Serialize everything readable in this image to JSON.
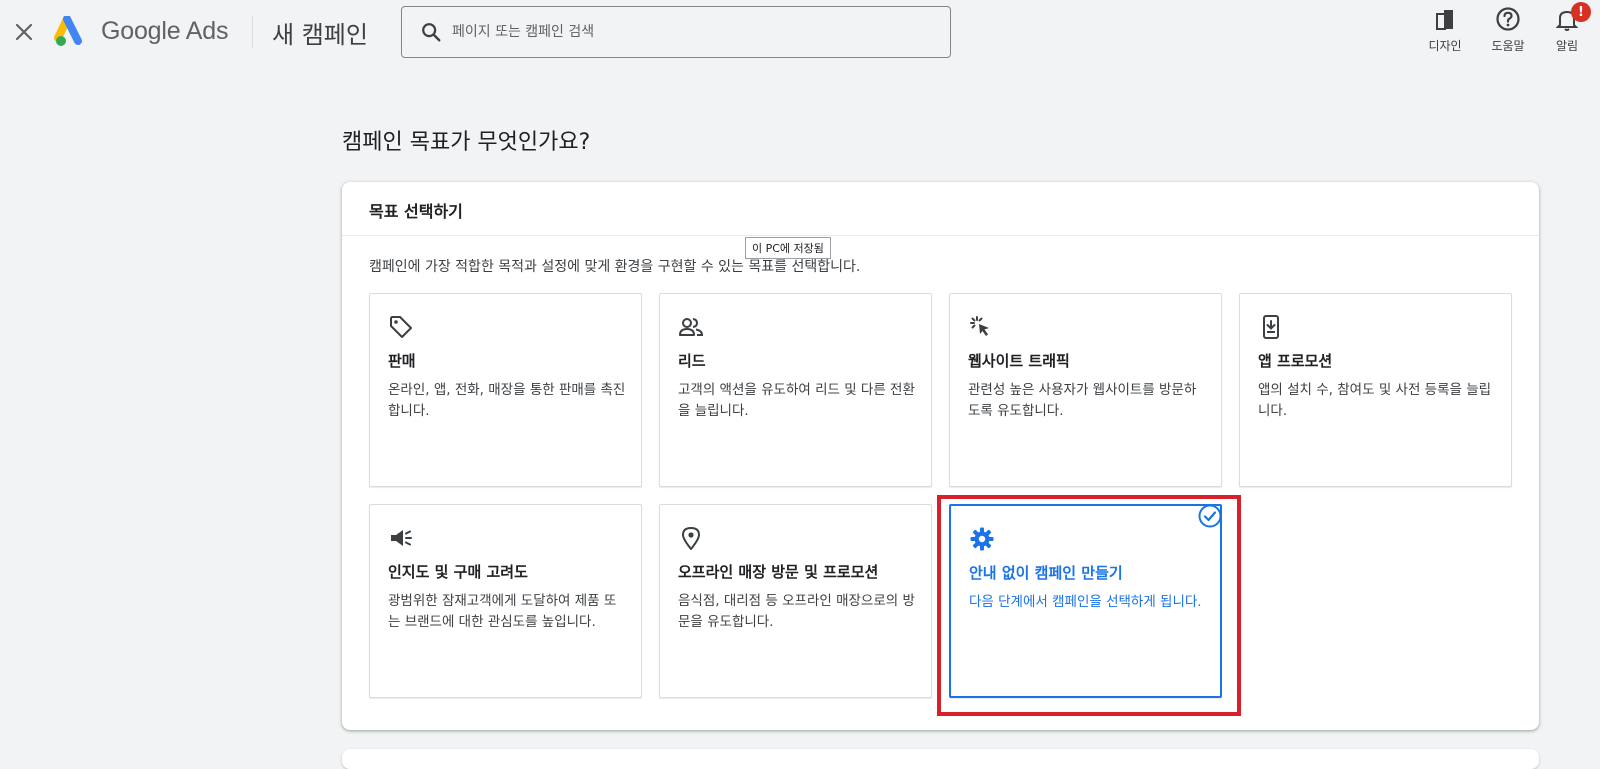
{
  "header": {
    "brand": "Google Ads",
    "page_title": "새 캠페인",
    "search_placeholder": "페이지 또는 캠페인 검색",
    "actions": [
      {
        "label": "디자인",
        "icon": "appearance-icon"
      },
      {
        "label": "도움말",
        "icon": "help-icon"
      },
      {
        "label": "알림",
        "icon": "notifications-icon",
        "badge": "!"
      }
    ]
  },
  "main": {
    "heading": "캠페인 목표가 무엇인가요?",
    "card": {
      "title": "목표 선택하기",
      "description": "캠페인에 가장 적합한 목적과 설정에 맞게 환경을 구현할 수 있는 목표를 선택합니다.",
      "tooltip": "이 PC에 저장됨",
      "goals": [
        {
          "title": "판매",
          "desc": "온라인, 앱, 전화, 매장을 통한 판매를 촉진합니다.",
          "icon": "tag-icon"
        },
        {
          "title": "리드",
          "desc": "고객의 액션을 유도하여 리드 및 다른 전환을 늘립니다.",
          "icon": "people-icon"
        },
        {
          "title": "웹사이트 트래픽",
          "desc": "관련성 높은 사용자가 웹사이트를 방문하도록 유도합니다.",
          "icon": "cursor-click-icon"
        },
        {
          "title": "앱 프로모션",
          "desc": "앱의 설치 수, 참여도 및 사전 등록을 늘립니다.",
          "icon": "phone-download-icon"
        },
        {
          "title": "인지도 및 구매 고려도",
          "desc": "광범위한 잠재고객에게 도달하여 제품 또는 브랜드에 대한 관심도를 높입니다.",
          "icon": "megaphone-icon"
        },
        {
          "title": "오프라인 매장 방문 및 프로모션",
          "desc": "음식점, 대리점 등 오프라인 매장으로의 방문을 유도합니다.",
          "icon": "location-pin-icon"
        },
        {
          "title": "안내 없이 캠페인 만들기",
          "desc": "다음 단계에서 캠페인을 선택하게 됩니다.",
          "icon": "gear-icon",
          "selected": true
        }
      ]
    }
  },
  "colors": {
    "accent": "#1a73e8",
    "highlight": "#d9202a",
    "badge": "#d93025"
  }
}
